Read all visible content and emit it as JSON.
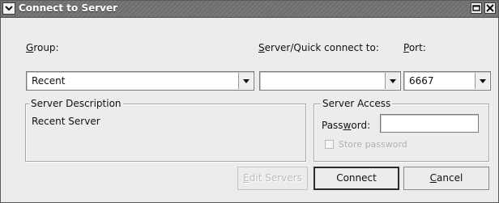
{
  "window": {
    "title": "Connect to Server",
    "menu_icon": "chevron-down-icon",
    "minimize_icon": "minimize-icon",
    "close_icon": "close-icon"
  },
  "labels": {
    "group": "Group:",
    "group_mnemonic": "G",
    "group_rest": "roup:",
    "server": "Server/Quick connect to:",
    "server_mnemonic": "S",
    "server_rest": "erver/Quick connect to:",
    "port": "Port:",
    "port_mnemonic": "P",
    "port_rest": "ort:"
  },
  "group_combo": {
    "value": "Recent"
  },
  "server_combo": {
    "value": ""
  },
  "port_combo": {
    "value": "6667"
  },
  "server_description": {
    "title": "Server Description",
    "text": "Recent Server"
  },
  "server_access": {
    "title": "Server Access",
    "password_label": "Password:",
    "password_pre": "Pass",
    "password_mnemonic": "w",
    "password_post": "ord:",
    "password_value": "",
    "store_password_label": "Store password",
    "store_password_checked": false
  },
  "buttons": {
    "edit_servers": "Edit Servers",
    "edit_mnemonic": "E",
    "edit_rest": "dit Servers",
    "connect": "Connect",
    "cancel": "Cancel",
    "cancel_mnemonic": "C",
    "cancel_rest": "ancel"
  }
}
